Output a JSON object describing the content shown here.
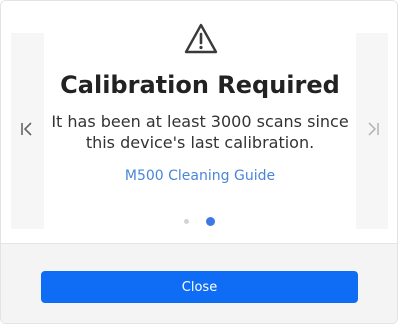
{
  "dialog": {
    "title": "Calibration Required",
    "message": "It has been at least 3000 scans since this device's last calibration.",
    "link_text": "M500 Cleaning Guide",
    "close_label": "Close"
  },
  "carousel": {
    "page_count": 2,
    "current_page": 2
  },
  "icons": {
    "warning": "warning-triangle-icon",
    "prev": "skip-previous-icon",
    "next": "skip-next-icon"
  },
  "colors": {
    "accent": "#0f6cf5",
    "link": "#4a86d8",
    "dot_active": "#3e78e0",
    "dot_inactive": "#d4d4d4",
    "title": "#222222"
  }
}
